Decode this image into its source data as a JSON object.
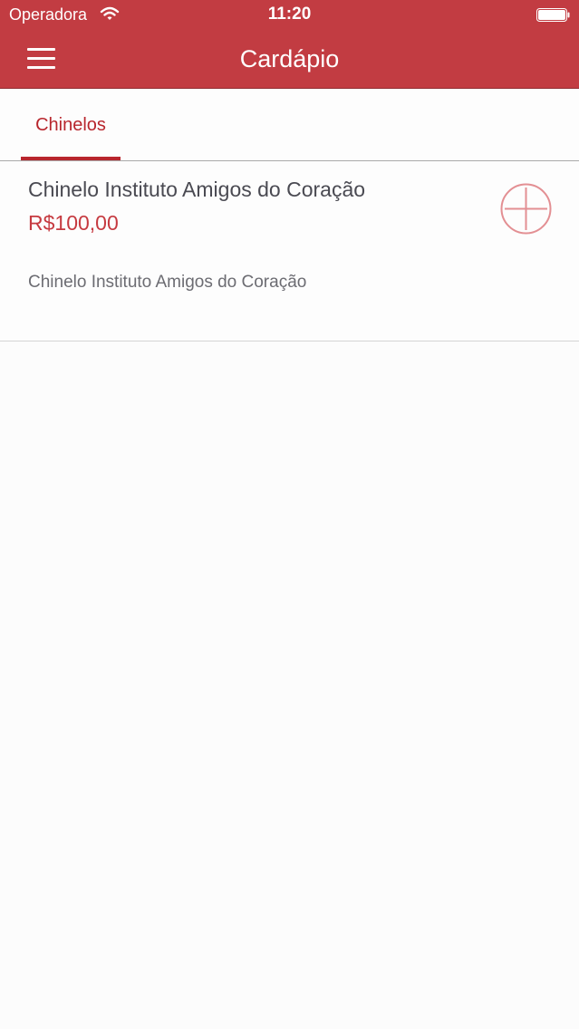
{
  "status_bar": {
    "carrier": "Operadora",
    "time": "11:20",
    "wifi_icon": "wifi-icon",
    "battery_icon": "battery-icon"
  },
  "nav": {
    "title": "Cardápio",
    "menu_icon": "hamburger-menu-icon"
  },
  "tabs": [
    {
      "label": "Chinelos",
      "selected": true
    }
  ],
  "products": [
    {
      "name": "Chinelo Instituto Amigos do Coração",
      "price": "R$100,00",
      "description": "Chinelo Instituto Amigos do Coração",
      "add_icon": "add-circle-icon"
    }
  ],
  "colors": {
    "header_background": "#c23c42",
    "accent": "#b8262d",
    "price": "#c63a40",
    "add_icon": "#e38f93",
    "background": "#fcfcfc"
  }
}
